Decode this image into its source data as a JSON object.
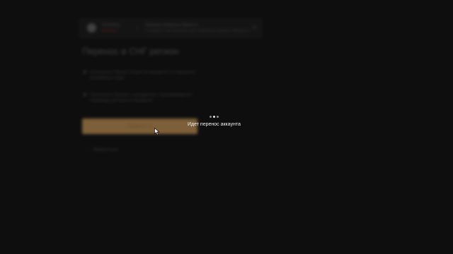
{
  "topbar": {
    "brand_title": "Steamkey",
    "brand_sub": "магазин",
    "nav_line_1": "Перенос аккаунта Steam в",
    "nav_line_2": "Следуйте инструкции для переноса вашего аккаунта"
  },
  "page": {
    "title": "Перенос в СНГ регион"
  },
  "steps": [
    {
      "text": "Отключите Steam Guard на аккаунте и сохраните резервные коды"
    },
    {
      "text": "Пополните баланс и дождитесь подтверждения перевода региона в профиле"
    }
  ],
  "transfer_button": {
    "label": "Перенести"
  },
  "back_link": {
    "label": "Вернуться"
  },
  "overlay": {
    "loading_text": "Идет перенос аккаунта"
  },
  "colors": {
    "accent": "#b48a52",
    "background": "#131313",
    "overlay_text": "#f0f0f0"
  },
  "icons": {
    "logo": "steam-logo-icon",
    "nav": "chevron-right-icon",
    "close": "close-icon",
    "back": "arrow-left-icon",
    "loader": "loading-dots-icon",
    "cursor": "cursor-icon"
  }
}
